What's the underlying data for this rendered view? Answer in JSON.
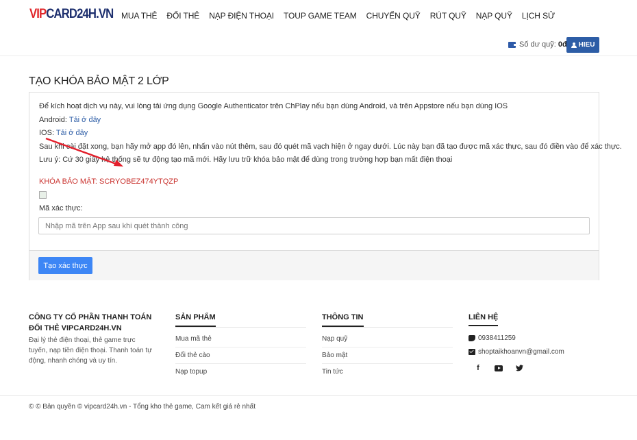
{
  "header": {
    "logo_part1": "VIP",
    "logo_part2": "CARD24H.VN",
    "nav": [
      "MUA THẺ",
      "ĐỔI THẺ",
      "NẠP ĐIỆN THOẠI",
      "TOUP GAME TEAM",
      "CHUYỂN QUỸ",
      "RÚT QUỸ",
      "NẠP QUỸ",
      "LỊCH SỬ"
    ],
    "balance_label": "Số dư quỹ:",
    "balance_value": "0đ",
    "user_button": "HIEU"
  },
  "main": {
    "title": "TẠO KHÓA BẢO MẬT 2 LỚP",
    "intro": "Để kích hoạt dịch vụ này, vui lòng tải ứng dụng Google Authenticator trên ChPlay nếu bạn dùng Android, và trên Appstore nếu bạn dùng IOS",
    "android_label": "Android:",
    "android_link": "Tải ở đây",
    "ios_label": "IOS:",
    "ios_link": "Tải ở đây",
    "instructions": "Sau khi cài đặt xong, bạn hãy mở app đó lên, nhấn vào nút thêm, sau đó quét mã vạch hiện ở ngay dưới. Lúc này bạn đã tạo được mã xác thực, sau đó điền vào để xác thực.",
    "note": "Lưu ý: Cứ 30 giây hệ thống sẽ tự động tạo mã mới. Hãy lưu trữ khóa bảo mật để dùng trong trường hợp bạn mất điện thoại",
    "secret_key": "KHÓA BẢO MẬT: SCRYOBEZ474YTQZP",
    "code_label": "Mã xác thực:",
    "code_placeholder": "Nhập mã trên App sau khi quét thành công",
    "submit_label": "Tạo xác thực"
  },
  "footer": {
    "company": "CÔNG TY CỔ PHẦN THANH TOÁN ĐỔI THẺ VIPCARD24H.VN",
    "company_desc": "Đại lý thẻ điện thoại, thẻ game trực tuyến, nạp tiền điện thoại. Thanh toán tự động, nhanh chóng và uy tín.",
    "products_title": "SẢN PHẨM",
    "products": [
      "Mua mã thẻ",
      "Đổi thẻ cào",
      "Nạp topup"
    ],
    "info_title": "THÔNG TIN",
    "info": [
      "Nạp quỹ",
      "Bảo mật",
      "Tin tức"
    ],
    "contact_title": "LIÊN HỆ",
    "phone": "0938411259",
    "email": "shoptaikhoanvn@gmail.com",
    "copyright": "© © Bản quyền © vipcard24h.vn - Tổng kho thẻ game, Cam kết giá rẻ nhất"
  },
  "annotation_color": "#e3202c"
}
